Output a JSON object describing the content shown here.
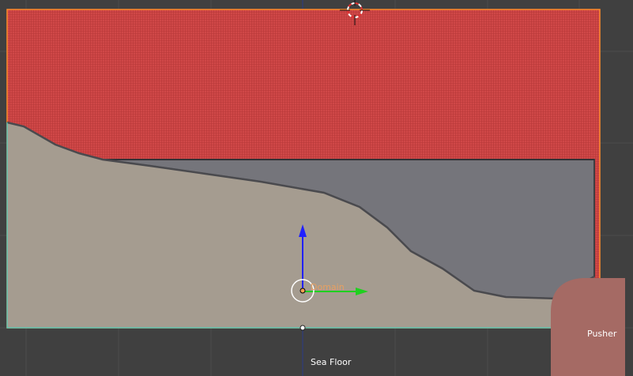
{
  "viewport": {
    "background_color": "#404040",
    "grid_color": "#4c4c4c"
  },
  "objects": {
    "domain": {
      "label": "Domain",
      "fill_color": "#d04848",
      "outline_color": "#ff8c2a",
      "label_color": "#e8a060"
    },
    "sea_floor": {
      "label": "Sea Floor",
      "fill_color": "#a59c90",
      "outline_color": "#50d0c0"
    },
    "water": {
      "fill_color": "#75757b"
    },
    "pusher": {
      "label": "Pusher",
      "fill_color": "#a56a64"
    }
  },
  "gizmo": {
    "z_axis_color": "#2020ff",
    "y_axis_color": "#20d020",
    "center_ring_color": "#ffffff",
    "origin_color": "#f0a050"
  },
  "cursor_3d": {
    "icon": "3d-cursor-icon",
    "ring_colors": [
      "#ffffff",
      "#e03030"
    ]
  }
}
